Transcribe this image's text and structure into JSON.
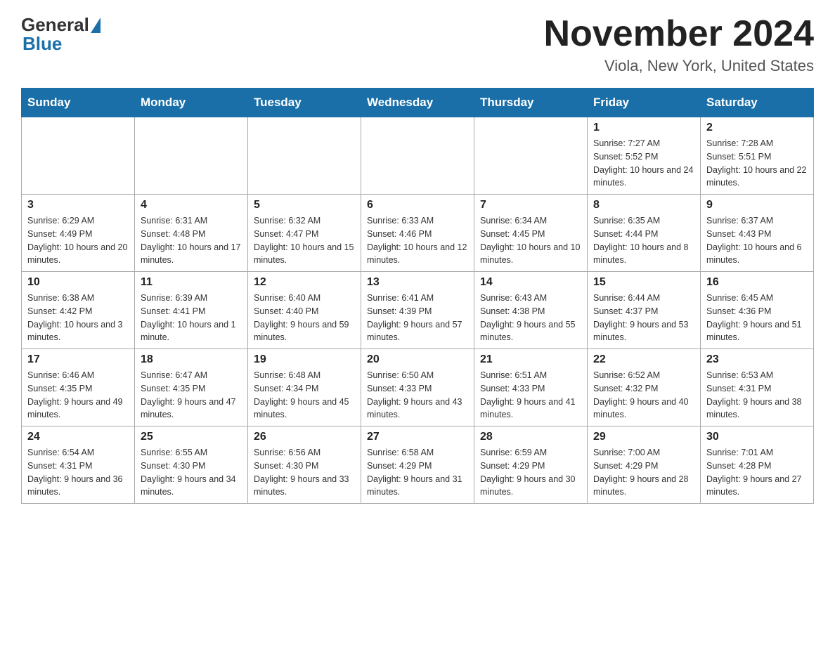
{
  "header": {
    "logo": {
      "general": "General",
      "blue": "Blue"
    },
    "title": "November 2024",
    "location": "Viola, New York, United States"
  },
  "days_of_week": [
    "Sunday",
    "Monday",
    "Tuesday",
    "Wednesday",
    "Thursday",
    "Friday",
    "Saturday"
  ],
  "weeks": [
    [
      {
        "day": "",
        "info": ""
      },
      {
        "day": "",
        "info": ""
      },
      {
        "day": "",
        "info": ""
      },
      {
        "day": "",
        "info": ""
      },
      {
        "day": "",
        "info": ""
      },
      {
        "day": "1",
        "info": "Sunrise: 7:27 AM\nSunset: 5:52 PM\nDaylight: 10 hours and 24 minutes."
      },
      {
        "day": "2",
        "info": "Sunrise: 7:28 AM\nSunset: 5:51 PM\nDaylight: 10 hours and 22 minutes."
      }
    ],
    [
      {
        "day": "3",
        "info": "Sunrise: 6:29 AM\nSunset: 4:49 PM\nDaylight: 10 hours and 20 minutes."
      },
      {
        "day": "4",
        "info": "Sunrise: 6:31 AM\nSunset: 4:48 PM\nDaylight: 10 hours and 17 minutes."
      },
      {
        "day": "5",
        "info": "Sunrise: 6:32 AM\nSunset: 4:47 PM\nDaylight: 10 hours and 15 minutes."
      },
      {
        "day": "6",
        "info": "Sunrise: 6:33 AM\nSunset: 4:46 PM\nDaylight: 10 hours and 12 minutes."
      },
      {
        "day": "7",
        "info": "Sunrise: 6:34 AM\nSunset: 4:45 PM\nDaylight: 10 hours and 10 minutes."
      },
      {
        "day": "8",
        "info": "Sunrise: 6:35 AM\nSunset: 4:44 PM\nDaylight: 10 hours and 8 minutes."
      },
      {
        "day": "9",
        "info": "Sunrise: 6:37 AM\nSunset: 4:43 PM\nDaylight: 10 hours and 6 minutes."
      }
    ],
    [
      {
        "day": "10",
        "info": "Sunrise: 6:38 AM\nSunset: 4:42 PM\nDaylight: 10 hours and 3 minutes."
      },
      {
        "day": "11",
        "info": "Sunrise: 6:39 AM\nSunset: 4:41 PM\nDaylight: 10 hours and 1 minute."
      },
      {
        "day": "12",
        "info": "Sunrise: 6:40 AM\nSunset: 4:40 PM\nDaylight: 9 hours and 59 minutes."
      },
      {
        "day": "13",
        "info": "Sunrise: 6:41 AM\nSunset: 4:39 PM\nDaylight: 9 hours and 57 minutes."
      },
      {
        "day": "14",
        "info": "Sunrise: 6:43 AM\nSunset: 4:38 PM\nDaylight: 9 hours and 55 minutes."
      },
      {
        "day": "15",
        "info": "Sunrise: 6:44 AM\nSunset: 4:37 PM\nDaylight: 9 hours and 53 minutes."
      },
      {
        "day": "16",
        "info": "Sunrise: 6:45 AM\nSunset: 4:36 PM\nDaylight: 9 hours and 51 minutes."
      }
    ],
    [
      {
        "day": "17",
        "info": "Sunrise: 6:46 AM\nSunset: 4:35 PM\nDaylight: 9 hours and 49 minutes."
      },
      {
        "day": "18",
        "info": "Sunrise: 6:47 AM\nSunset: 4:35 PM\nDaylight: 9 hours and 47 minutes."
      },
      {
        "day": "19",
        "info": "Sunrise: 6:48 AM\nSunset: 4:34 PM\nDaylight: 9 hours and 45 minutes."
      },
      {
        "day": "20",
        "info": "Sunrise: 6:50 AM\nSunset: 4:33 PM\nDaylight: 9 hours and 43 minutes."
      },
      {
        "day": "21",
        "info": "Sunrise: 6:51 AM\nSunset: 4:33 PM\nDaylight: 9 hours and 41 minutes."
      },
      {
        "day": "22",
        "info": "Sunrise: 6:52 AM\nSunset: 4:32 PM\nDaylight: 9 hours and 40 minutes."
      },
      {
        "day": "23",
        "info": "Sunrise: 6:53 AM\nSunset: 4:31 PM\nDaylight: 9 hours and 38 minutes."
      }
    ],
    [
      {
        "day": "24",
        "info": "Sunrise: 6:54 AM\nSunset: 4:31 PM\nDaylight: 9 hours and 36 minutes."
      },
      {
        "day": "25",
        "info": "Sunrise: 6:55 AM\nSunset: 4:30 PM\nDaylight: 9 hours and 34 minutes."
      },
      {
        "day": "26",
        "info": "Sunrise: 6:56 AM\nSunset: 4:30 PM\nDaylight: 9 hours and 33 minutes."
      },
      {
        "day": "27",
        "info": "Sunrise: 6:58 AM\nSunset: 4:29 PM\nDaylight: 9 hours and 31 minutes."
      },
      {
        "day": "28",
        "info": "Sunrise: 6:59 AM\nSunset: 4:29 PM\nDaylight: 9 hours and 30 minutes."
      },
      {
        "day": "29",
        "info": "Sunrise: 7:00 AM\nSunset: 4:29 PM\nDaylight: 9 hours and 28 minutes."
      },
      {
        "day": "30",
        "info": "Sunrise: 7:01 AM\nSunset: 4:28 PM\nDaylight: 9 hours and 27 minutes."
      }
    ]
  ]
}
